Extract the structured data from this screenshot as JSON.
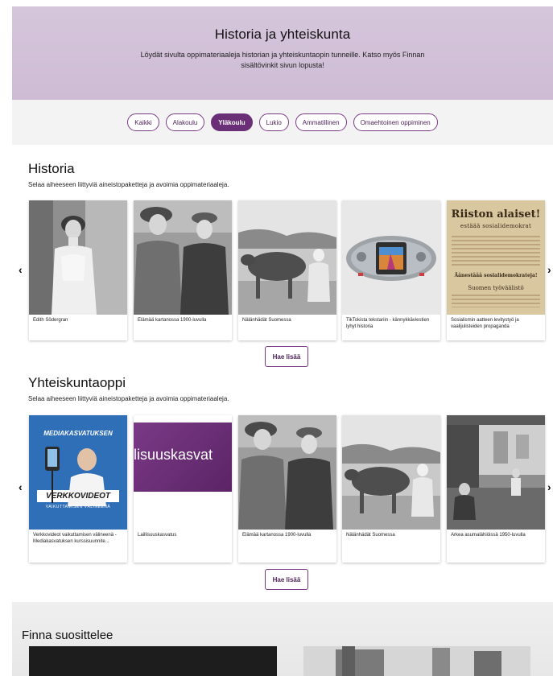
{
  "hero": {
    "title": "Historia ja yhteiskunta",
    "description": "Löydät sivulta oppimateriaaleja historian ja yhteiskuntaopin tunneille. Katso myös Finnan sisältövinkit sivun lopusta!"
  },
  "filters": [
    {
      "label": "Kaikki",
      "active": false
    },
    {
      "label": "Alakoulu",
      "active": false
    },
    {
      "label": "Yläkoulu",
      "active": true
    },
    {
      "label": "Lukio",
      "active": false
    },
    {
      "label": "Ammatillinen",
      "active": false
    },
    {
      "label": "Omaehtoinen oppiminen",
      "active": false
    }
  ],
  "historia": {
    "title": "Historia",
    "subtitle": "Selaa aiheeseen liittyviä aineistopaketteja ja avoimia oppimateriaaleja.",
    "cards": [
      {
        "caption": "Edith Södergran",
        "image": "portrait-woman-white-dress"
      },
      {
        "caption": "Elämää kartanossa 1900-luvulla",
        "image": "two-people-photo"
      },
      {
        "caption": "Nälänhädät Suomessa",
        "image": "cow-and-woman"
      },
      {
        "caption": "TikTokista tekstariin - kännykkäviestien lyhyt historia",
        "image": "nokia-phone"
      },
      {
        "caption": "Sosialismin aatteen levitystyö ja vaalijulisteiden propaganda",
        "image": "election-poster"
      }
    ],
    "more_label": "Hae lisää",
    "poster_text": {
      "line1": "Riiston alaiset!",
      "line2": "estäää sosialidemokrat",
      "line3": "Äänestäää sosialidemokrateja!",
      "line4": "Suomen työväälistö"
    }
  },
  "yhteiskuntaoppi": {
    "title": "Yhteiskuntaoppi",
    "subtitle": "Selaa aiheeseen liittyviä aineistopaketteja ja avoimia oppimateriaaleja.",
    "cards": [
      {
        "caption": "Verkkovideot vaikuttamisen välineenä - Mediakasvatuksen kurssisuunnite...",
        "image": "verkkovideot-cover"
      },
      {
        "caption": "Laillisuuskasvatus",
        "image": "laillisuuskasvatus-banner"
      },
      {
        "caption": "Elämää kartanossa 1900-luvulla",
        "image": "two-people-photo"
      },
      {
        "caption": "Nälänhädät Suomessa",
        "image": "cow-and-woman"
      },
      {
        "caption": "Arkea asumalähiöissä 1950-luvulla",
        "image": "apartment-room"
      }
    ],
    "more_label": "Hae lisää",
    "cover_text": {
      "top": "MEDIAKASVATUKSEN",
      "bottom": "VERKKOVIDEOT",
      "bottom_sub": "VAIKUTTAMISEN VÄLINEENÄ"
    },
    "banner_text": "illisuuskasvat"
  },
  "finna": {
    "title": "Finna suosittelee"
  },
  "colors": {
    "accent": "#6b2f78",
    "hero_bg": "#d3c3d9"
  }
}
